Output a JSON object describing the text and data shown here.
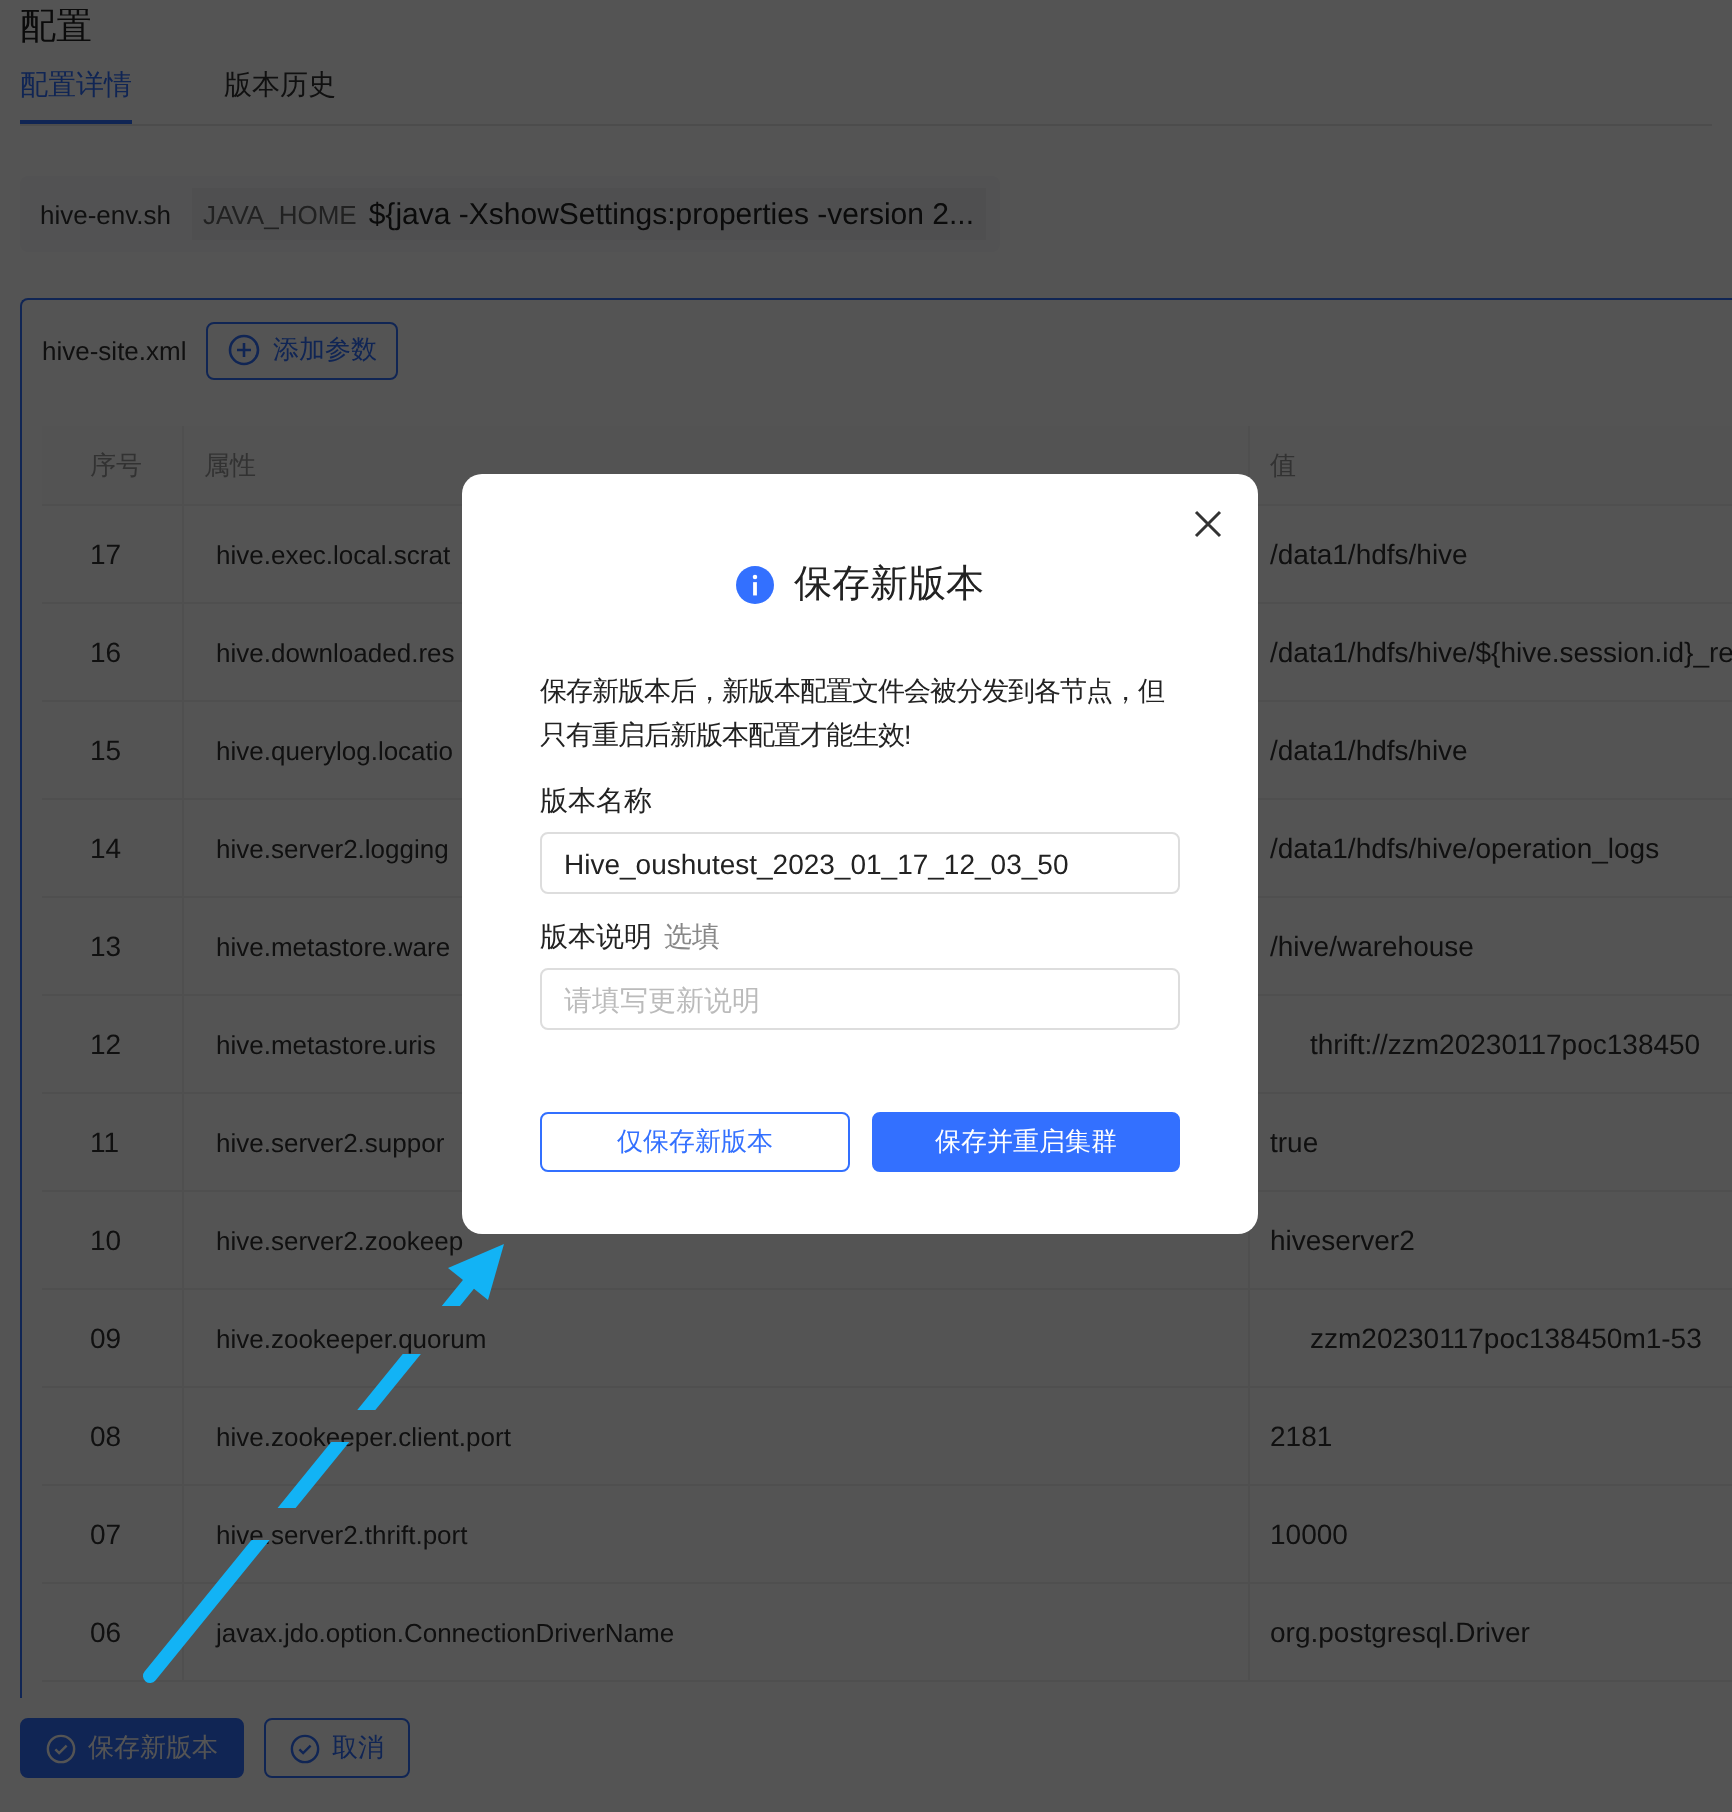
{
  "page_title": "配置",
  "tabs": [
    {
      "label": "配置详情",
      "selected": true
    },
    {
      "label": "版本历史",
      "selected": false
    }
  ],
  "env_file": {
    "name": "hive-env.sh",
    "key": "JAVA_HOME",
    "value": "${java -XshowSettings:properties -version 2..."
  },
  "site_file": {
    "name": "hive-site.xml",
    "add_button": "添加参数"
  },
  "table": {
    "columns": [
      "序号",
      "属性",
      "值"
    ],
    "rows": [
      {
        "index": "17",
        "property": "hive.exec.local.scrat",
        "value": "/data1/hdfs/hive",
        "indented": false
      },
      {
        "index": "16",
        "property": "hive.downloaded.res",
        "value": "/data1/hdfs/hive/${hive.session.id}_re",
        "indented": false
      },
      {
        "index": "15",
        "property": "hive.querylog.locatio",
        "value": "/data1/hdfs/hive",
        "indented": false
      },
      {
        "index": "14",
        "property": "hive.server2.logging",
        "value": "/data1/hdfs/hive/operation_logs",
        "indented": false
      },
      {
        "index": "13",
        "property": "hive.metastore.ware",
        "value": "/hive/warehouse",
        "indented": false
      },
      {
        "index": "12",
        "property": "hive.metastore.uris",
        "value": "thrift://zzm20230117poc138450",
        "indented": true
      },
      {
        "index": "11",
        "property": "hive.server2.suppor",
        "value": "true",
        "indented": false
      },
      {
        "index": "10",
        "property": "hive.server2.zookeep",
        "value": "hiveserver2",
        "indented": false
      },
      {
        "index": "09",
        "property": "hive.zookeeper.quorum",
        "value": "zzm20230117poc138450m1-53",
        "indented": true
      },
      {
        "index": "08",
        "property": "hive.zookeeper.client.port",
        "value": "2181",
        "indented": false
      },
      {
        "index": "07",
        "property": "hive.server2.thrift.port",
        "value": "10000",
        "indented": false
      },
      {
        "index": "06",
        "property": "javax.jdo.option.ConnectionDriverName",
        "value": "org.postgresql.Driver",
        "indented": false
      }
    ]
  },
  "footer_buttons": [
    {
      "label": "保存新版本",
      "kind": "primary"
    },
    {
      "label": "取消",
      "kind": "outline"
    }
  ],
  "dialog": {
    "title": "保存新版本",
    "message": "保存新版本后，新版本配置文件会被分发到各节点，但只有重启后新版本配置才能生效!",
    "name_label": "版本名称",
    "name_value": "Hive_oushutest_2023_01_17_12_03_50",
    "desc_label": "版本说明",
    "desc_optional": "选填",
    "desc_placeholder": "请填写更新说明",
    "buttons": [
      {
        "label": "仅保存新版本",
        "kind": "outline"
      },
      {
        "label": "保存并重启集群",
        "kind": "primary"
      }
    ]
  }
}
